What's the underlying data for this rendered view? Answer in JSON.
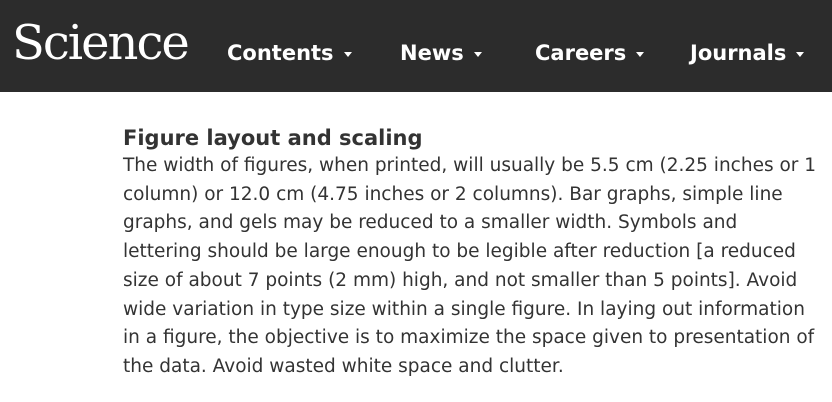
{
  "header": {
    "logo_text": "Science",
    "nav": [
      {
        "label": "Contents"
      },
      {
        "label": "News"
      },
      {
        "label": "Careers"
      },
      {
        "label": "Journals"
      }
    ],
    "background_color": "#2c2c2c"
  },
  "article": {
    "heading": "Figure layout and scaling",
    "lines": [
      "The width of figures, when printed, will usually be 5.5 cm (2.25 inches or 1",
      "column) or 12.0 cm (4.75 inches or 2 columns). Bar graphs, simple line",
      "graphs, and gels may be reduced to a smaller width. Symbols and",
      "lettering should be large enough to be legible after reduction [a reduced",
      "size of about 7 points (2 mm) high, and not smaller than 5 points]. Avoid",
      "wide variation in type size within a single figure. In laying out information",
      "in a figure, the objective is to maximize the space given to presentation of",
      "the data. Avoid wasted white space and clutter."
    ]
  }
}
